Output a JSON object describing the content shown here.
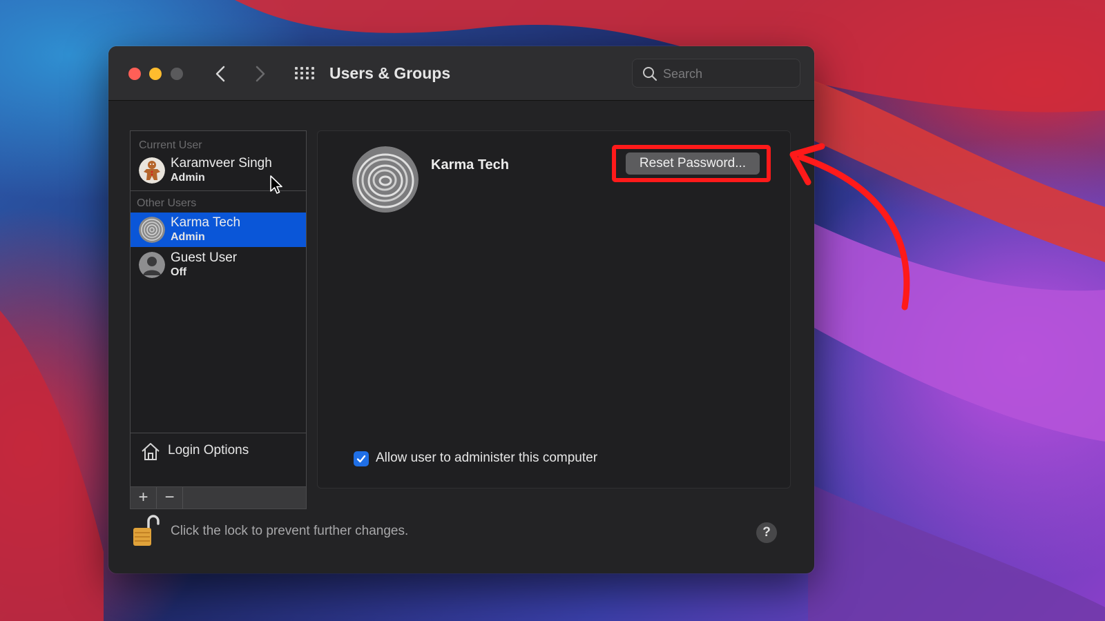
{
  "window": {
    "title": "Users & Groups"
  },
  "search": {
    "placeholder": "Search",
    "icon": "search-icon"
  },
  "sidebar": {
    "current_user_label": "Current User",
    "other_users_label": "Other Users",
    "users": [
      {
        "name": "Karamveer Singh",
        "role": "Admin",
        "avatar": "gingerbread-avatar"
      },
      {
        "name": "Karma Tech",
        "role": "Admin",
        "avatar": "fingerprint-avatar",
        "selected": true
      },
      {
        "name": "Guest User",
        "role": "Off",
        "avatar": "person-avatar"
      }
    ],
    "login_options_label": "Login Options",
    "add_label": "+",
    "remove_label": "−"
  },
  "detail": {
    "name": "Karma Tech",
    "reset_password_label": "Reset Password...",
    "admin_checkbox_label": "Allow user to administer this computer",
    "admin_checkbox_checked": true
  },
  "footer": {
    "lock_text": "Click the lock to prevent further changes.",
    "help_label": "?"
  },
  "colors": {
    "selection": "#0a56d8",
    "highlight": "#ff1a1a",
    "checkbox": "#1f6fe6"
  }
}
